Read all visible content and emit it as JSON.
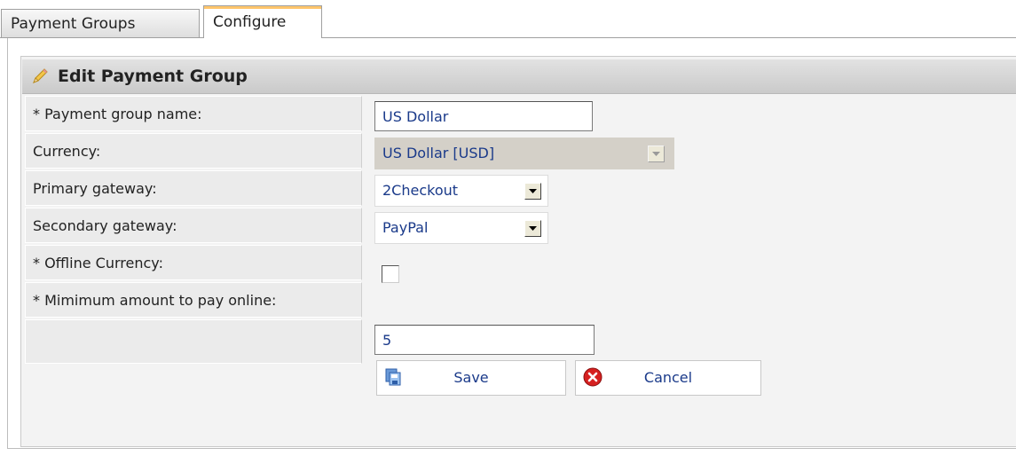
{
  "tabs": [
    {
      "label": "Payment Groups",
      "active": false
    },
    {
      "label": "Configure",
      "active": true
    }
  ],
  "panel": {
    "title": "Edit Payment Group",
    "icon": "pencil-icon"
  },
  "form": {
    "group_name": {
      "label": "* Payment group name:",
      "value": "US Dollar"
    },
    "currency": {
      "label": "Currency:",
      "value": "US Dollar [USD]",
      "disabled": true
    },
    "primary_gateway": {
      "label": "Primary gateway:",
      "value": "2Checkout"
    },
    "secondary_gateway": {
      "label": "Secondary gateway:",
      "value": "PayPal"
    },
    "offline_currency": {
      "label": "* Offline Currency:",
      "checked": false
    },
    "min_amount": {
      "label": "* Mimimum amount to pay online:",
      "value": "5"
    }
  },
  "actions": {
    "save_label": "Save",
    "save_icon": "save-copy-icon",
    "cancel_label": "Cancel",
    "cancel_icon": "red-x-cancel-icon"
  },
  "colors": {
    "active_tab_accent": "#ffc56b",
    "value_text": "#1a3a8a",
    "cancel_icon_red": "#d62020"
  }
}
